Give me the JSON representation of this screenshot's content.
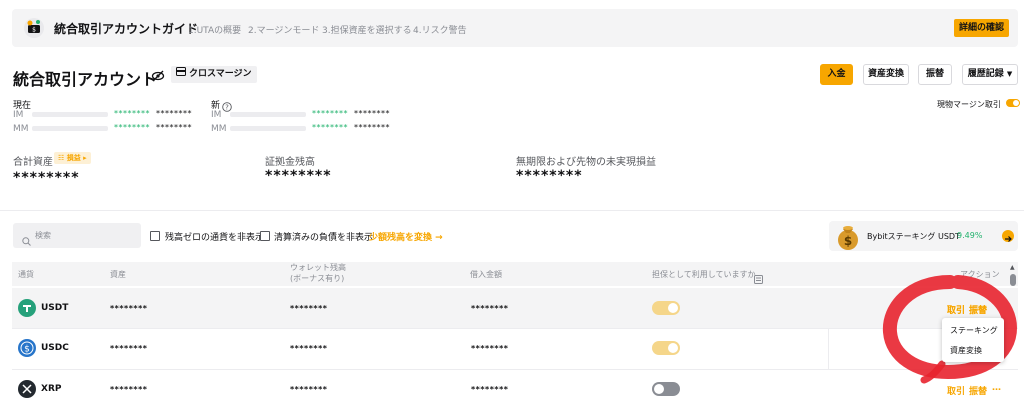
{
  "guide": {
    "title": "統合取引アカウントガイド",
    "steps": [
      "1.UTAの概要",
      "2.マージンモード",
      "3.担保資産を選択する",
      "4.リスク警告"
    ],
    "detail_button": "詳細の確認"
  },
  "account": {
    "title": "統合取引アカウント",
    "margin_tag": "クロスマージン",
    "buttons": {
      "deposit": "入金",
      "convert": "資産変換",
      "transfer": "振替",
      "history": "履歴記録"
    },
    "current_label": "現在",
    "new_label": "新",
    "im_label": "IM",
    "mm_label": "MM",
    "mask_value": "********",
    "spot_margin_label": "現物マージン取引",
    "spot_margin_on": true
  },
  "summary": {
    "total_assets_label": "合計資産",
    "pnl_badge": "損益",
    "total_assets_value": "********",
    "margin_balance_label": "証拠金残高",
    "margin_balance_value": "********",
    "unrealized_label": "無期限および先物の未実現損益",
    "unrealized_value": "********"
  },
  "filters": {
    "search_placeholder": "検索",
    "hide_zero_label": "残高ゼロの通貨を非表示",
    "hide_settled_label": "清算済みの負債を非表示",
    "convert_small_label": "少額残高を変換 →"
  },
  "promo": {
    "text": "Bybitステーキング USDT",
    "rate": "9.49%"
  },
  "table": {
    "headers": {
      "coin": "通貨",
      "assets": "資産",
      "wallet_line1": "ウォレット残高",
      "wallet_line2": "(ボーナス有り)",
      "borrowed": "借入金額",
      "collateral": "担保として利用していますか",
      "action": "アクション"
    },
    "rows": [
      {
        "coin": "USDT",
        "assets": "********",
        "wallet": "********",
        "borrowed": "********",
        "collateral": true,
        "actions": [
          "取引",
          "振替"
        ]
      },
      {
        "coin": "USDC",
        "assets": "********",
        "wallet": "********",
        "borrowed": "********",
        "collateral": true,
        "actions": []
      },
      {
        "coin": "XRP",
        "assets": "********",
        "wallet": "********",
        "borrowed": "********",
        "collateral": false,
        "actions": [
          "取引",
          "振替",
          "…"
        ]
      }
    ]
  },
  "popup": {
    "items": [
      "ステーキング",
      "資産変換"
    ]
  },
  "colors": {
    "accent": "#f7a600",
    "green": "#20b26c",
    "annotation_red": "#e8242f",
    "toggle_disabled_on": "#f5d68a",
    "toggle_off": "#8a8d94"
  }
}
